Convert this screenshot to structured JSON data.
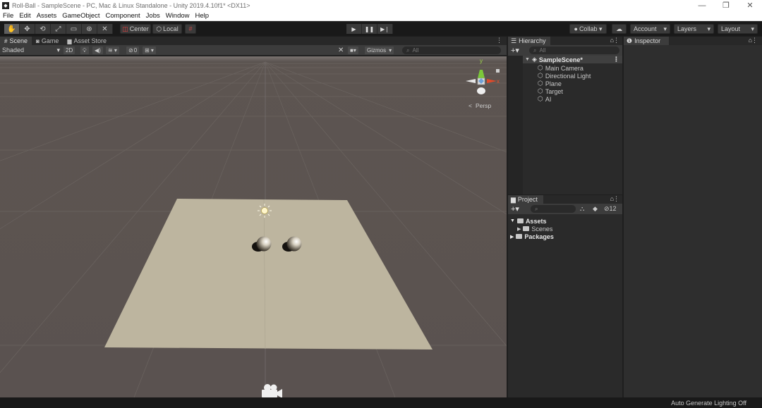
{
  "window": {
    "title": "Roll-Ball - SampleScene - PC, Mac & Linux Standalone - Unity 2019.4.10f1* <DX11>",
    "minimize": "—",
    "restore": "❐",
    "close": "✕"
  },
  "menu": [
    "File",
    "Edit",
    "Assets",
    "GameObject",
    "Component",
    "Jobs",
    "Window",
    "Help"
  ],
  "toolbar": {
    "pivot_label": "Center",
    "space_label": "Local",
    "collab_label": "Collab ▾",
    "account_label": "Account",
    "layers_label": "Layers",
    "layout_label": "Layout",
    "dropdown_arrow": "▾"
  },
  "scene_tabs": [
    {
      "label": "Scene",
      "icon": "grid-icon",
      "active": true
    },
    {
      "label": "Game",
      "icon": "gamepad-icon",
      "active": false
    },
    {
      "label": "Asset Store",
      "icon": "bag-icon",
      "active": false
    }
  ],
  "scene_toolbar": {
    "shading_mode": "Shaded",
    "mode_2d": "2D",
    "hidden_count": "0",
    "gizmos_label": "Gizmos",
    "search_placeholder": "All"
  },
  "scene_view": {
    "projection_label": "Persp",
    "axis_y": "y",
    "axis_x": "x"
  },
  "hierarchy": {
    "tab_label": "Hierarchy",
    "search_placeholder": "All",
    "scene_name": "SampleScene*",
    "objects": [
      "Main Camera",
      "Directional Light",
      "Plane",
      "Target",
      "AI"
    ]
  },
  "project": {
    "tab_label": "Project",
    "hidden_count": "12",
    "folders": [
      {
        "label": "Assets",
        "expanded": true
      },
      {
        "label": "Scenes",
        "expanded": false
      },
      {
        "label": "Packages",
        "expanded": false
      }
    ]
  },
  "inspector": {
    "tab_label": "Inspector"
  },
  "status": {
    "text": "Auto Generate Lighting Off"
  },
  "colors": {
    "editor_bg": "#383838",
    "scene_ground": "#5a5350",
    "plane": "#bcb59e"
  }
}
